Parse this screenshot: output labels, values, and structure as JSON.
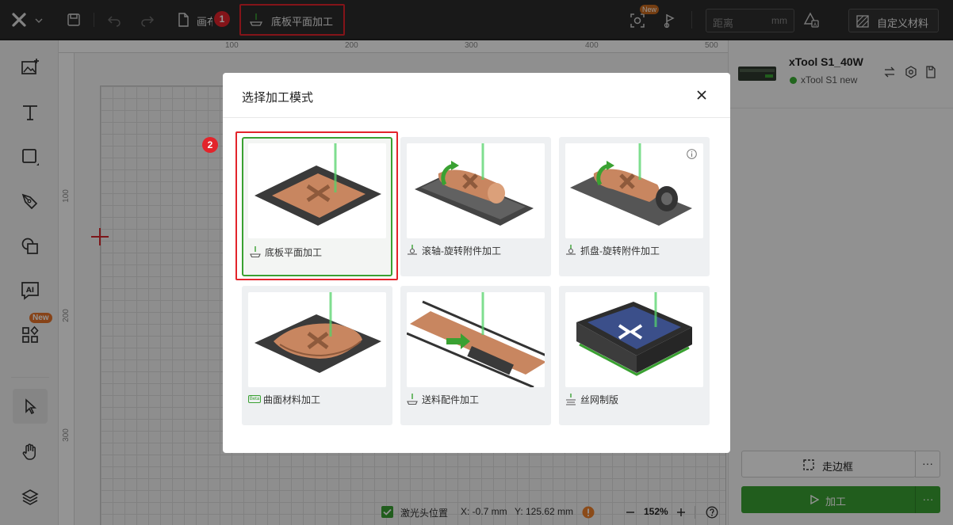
{
  "topbar": {
    "canvas_label": "画布",
    "mode_button_label": "底板平面加工",
    "distance_placeholder": "距离",
    "distance_unit": "mm",
    "new_badge": "New",
    "materials_button_label": "自定义材料"
  },
  "annotations": {
    "badge1": "1",
    "badge2": "2"
  },
  "ruler": {
    "top_ticks": [
      "100",
      "200",
      "300",
      "400",
      "500"
    ],
    "left_ticks": [
      "100",
      "200",
      "300"
    ]
  },
  "left_tools": {
    "new_badge": "New"
  },
  "device": {
    "name": "xTool S1_40W",
    "status": "xTool S1 new",
    "status_color": "#3cb035"
  },
  "dialog": {
    "title": "选择加工模式",
    "modes": [
      {
        "label": "底板平面加工",
        "selected": true
      },
      {
        "label": "滚轴-旋转附件加工"
      },
      {
        "label": "抓盘-旋转附件加工"
      },
      {
        "label": "曲面材料加工",
        "beta_badge": "Beta"
      },
      {
        "label": "送料配件加工"
      },
      {
        "label": "丝网制版"
      }
    ]
  },
  "actions": {
    "frame_label": "走边框",
    "process_label": "加工",
    "more_label": "···"
  },
  "statusbar": {
    "laser_pos_label": "激光头位置",
    "x_readout": "X: -0.7 mm",
    "y_readout": "Y: 125.62 mm",
    "zoom": "152%"
  },
  "colors": {
    "accent_green": "#3aa132",
    "highlight_red": "#e3242b",
    "topbar_bg": "#2b2b2b",
    "warning_orange": "#f0812b"
  }
}
